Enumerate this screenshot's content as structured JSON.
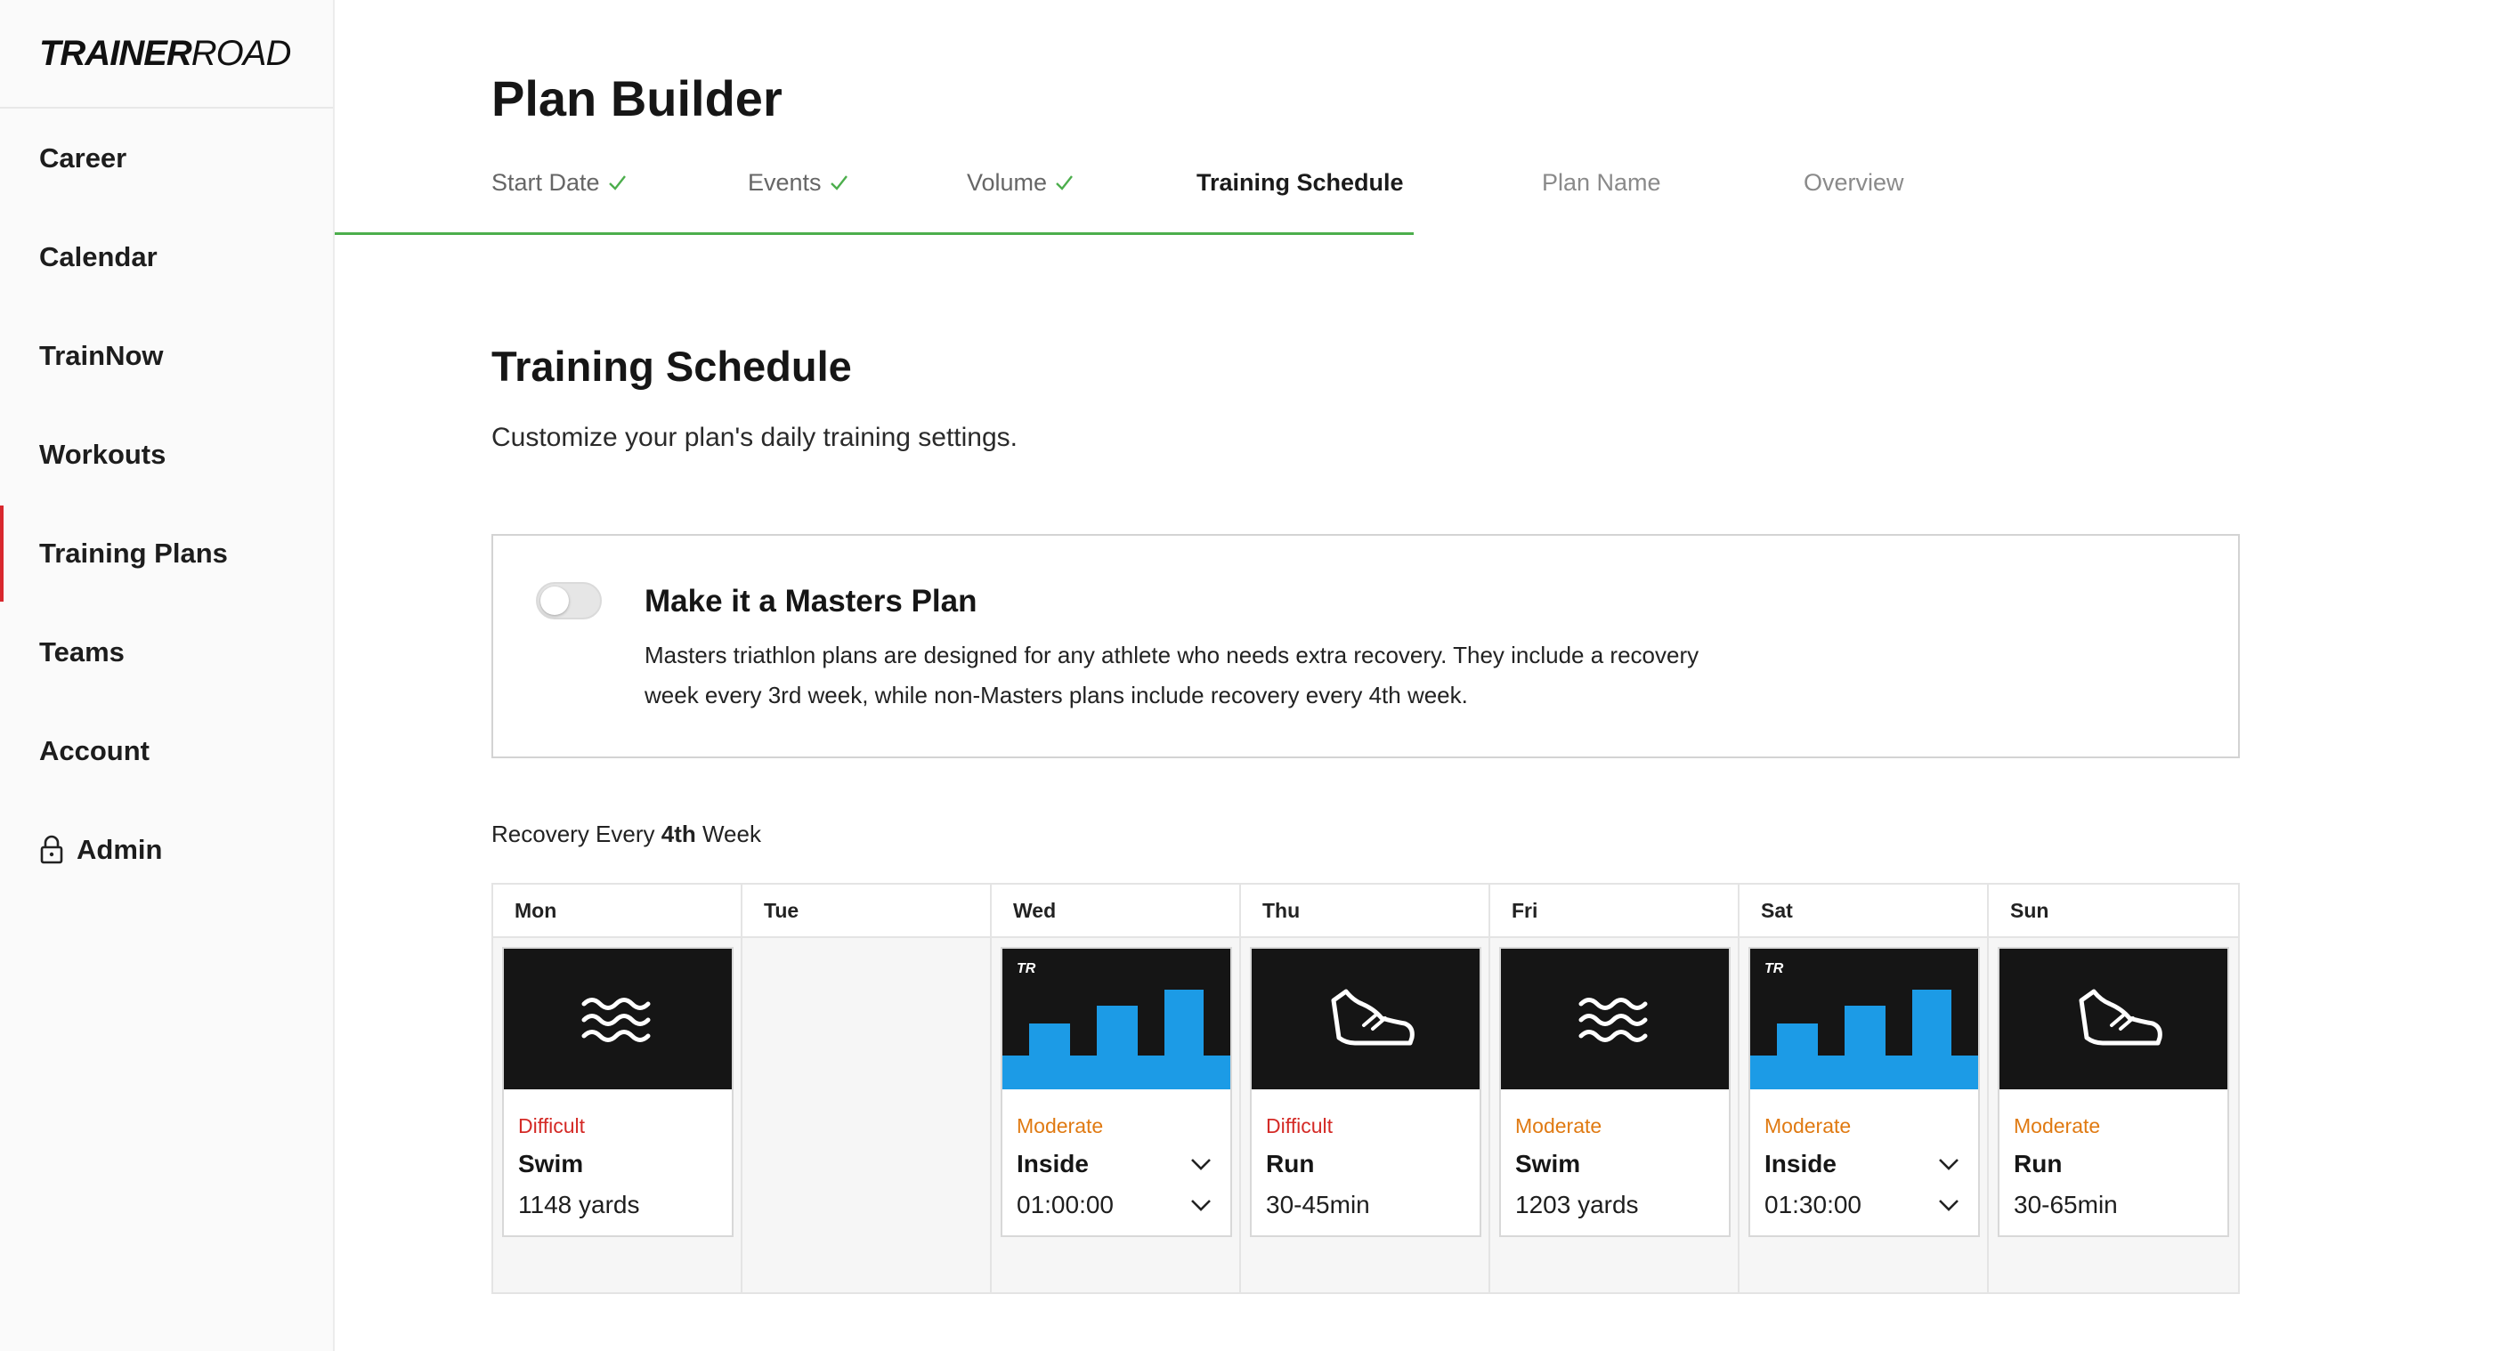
{
  "brand": {
    "logo_bold": "TRAINER",
    "logo_light": "ROAD"
  },
  "sidebar": {
    "items": [
      {
        "label": "Career"
      },
      {
        "label": "Calendar"
      },
      {
        "label": "TrainNow"
      },
      {
        "label": "Workouts"
      },
      {
        "label": "Training Plans",
        "active": true
      },
      {
        "label": "Teams"
      },
      {
        "label": "Account"
      },
      {
        "label": "Admin",
        "icon": "lock-icon"
      }
    ]
  },
  "header": {
    "title": "Plan Builder",
    "steps": [
      {
        "label": "Start Date",
        "status": "done"
      },
      {
        "label": "Events",
        "status": "done"
      },
      {
        "label": "Volume",
        "status": "done"
      },
      {
        "label": "Training Schedule",
        "status": "current"
      },
      {
        "label": "Plan Name",
        "status": "todo"
      },
      {
        "label": "Overview",
        "status": "todo"
      }
    ]
  },
  "section": {
    "title": "Training Schedule",
    "subtitle": "Customize your plan's daily training settings."
  },
  "masters": {
    "title": "Make it a Masters Plan",
    "description": "Masters triathlon plans are designed for any athlete who needs extra recovery. They include a recovery week every 3rd week, while non-Masters plans include recovery every 4th week.",
    "enabled": false
  },
  "recovery": {
    "prefix": "Recovery Every ",
    "value": "4th",
    "suffix": " Week"
  },
  "week": {
    "days": [
      {
        "name": "Mon",
        "card": {
          "image": "swim",
          "intensity": "Difficult",
          "intensity_level": "difficult",
          "type": "Swim",
          "detail": "1148 yards"
        }
      },
      {
        "name": "Tue",
        "card": null
      },
      {
        "name": "Wed",
        "card": {
          "image": "bike",
          "intensity": "Moderate",
          "intensity_level": "moderate",
          "type": "Inside",
          "detail": "01:00:00",
          "dropdowns": true
        }
      },
      {
        "name": "Thu",
        "card": {
          "image": "run",
          "intensity": "Difficult",
          "intensity_level": "difficult",
          "type": "Run",
          "detail": "30-45min"
        }
      },
      {
        "name": "Fri",
        "card": {
          "image": "swim",
          "intensity": "Moderate",
          "intensity_level": "moderate",
          "type": "Swim",
          "detail": "1203 yards"
        }
      },
      {
        "name": "Sat",
        "card": {
          "image": "bike",
          "intensity": "Moderate",
          "intensity_level": "moderate",
          "type": "Inside",
          "detail": "01:30:00",
          "dropdowns": true
        }
      },
      {
        "name": "Sun",
        "card": {
          "image": "run",
          "intensity": "Moderate",
          "intensity_level": "moderate",
          "type": "Run",
          "detail": "30-65min"
        }
      }
    ],
    "tr_mark": "TR"
  },
  "colors": {
    "accent_red": "#d8272d",
    "progress_green": "#4cae4c",
    "difficult": "#d42a26",
    "moderate": "#e07a12",
    "bike_blue": "#1c9be6"
  }
}
